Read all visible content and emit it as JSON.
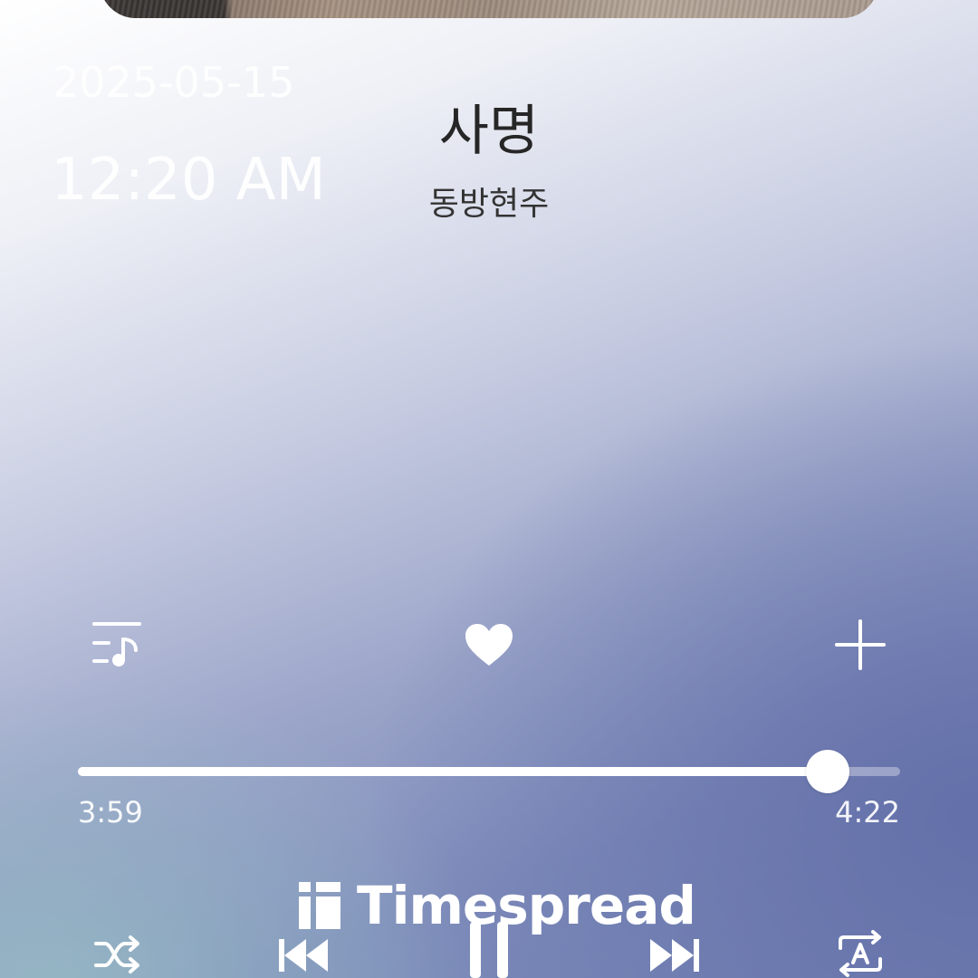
{
  "lockscreen": {
    "date": "2025-05-15",
    "time": "12:20 AM"
  },
  "track": {
    "title": "사명",
    "artist": "동방현주"
  },
  "actions": {
    "playlist_icon": "playlist-music-icon",
    "like_icon": "heart-filled-icon",
    "add_icon": "plus-icon"
  },
  "progress": {
    "elapsed": "3:59",
    "duration": "4:22",
    "fraction": 0.912
  },
  "controls": {
    "shuffle_icon": "shuffle-icon",
    "previous_icon": "skip-previous-icon",
    "pause_icon": "pause-icon",
    "next_icon": "skip-next-icon",
    "repeat_icon": "repeat-a-icon"
  },
  "watermark": {
    "text": "Timespread"
  },
  "colors": {
    "title_text": "#262626",
    "accent_white": "#ffffff"
  }
}
